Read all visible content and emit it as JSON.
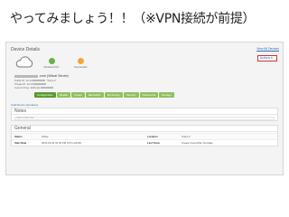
{
  "slide": {
    "title": "やってみましょう！！（※VPN接続が前提）"
  },
  "screenshot": {
    "header_title": "Device Details",
    "view_all_label": "View All Devices",
    "actions_label": "Actions ▾",
    "states": [
      {
        "label": "Powered On",
        "icon": "power-icon",
        "color": "#6ab04c"
      },
      {
        "label": "Connected",
        "icon": "connected-icon",
        "color": "#f2a63a"
      }
    ],
    "device_name_suffix": ".com (Virtual Server)",
    "info": [
      {
        "prefix": "Public IP: 10.13.",
        "suffix": " Tokyo 2"
      },
      {
        "prefix": "Private IP: 10.13.",
        "suffix": ""
      },
      {
        "prefix": "Current Time: 2015-02-",
        "suffix": ""
      }
    ],
    "tabs": [
      {
        "label": "Configuration",
        "active": true
      },
      {
        "label": "Details",
        "active": false
      },
      {
        "label": "Usage",
        "active": false
      },
      {
        "label": "Bandwidth",
        "active": false
      },
      {
        "label": "Monitoring",
        "active": false
      },
      {
        "label": "Security",
        "active": false
      },
      {
        "label": "Passwords",
        "active": false
      },
      {
        "label": "Storage",
        "active": false
      }
    ],
    "quick_link": "Audit Device Operations",
    "notes": {
      "title": "Notes",
      "placeholder": "Click to add note"
    },
    "general": {
      "title": "General",
      "rows": [
        {
          "k1": "Status",
          "v1": "Active",
          "k2": "Location",
          "v2": "Tokyo 2"
        },
        {
          "k1": "Start Date",
          "v1": "2015-02-02 02:39 PM (UTC+09:00)",
          "k2": "Last Trans",
          "v2": "Create Cloud Disk Template"
        }
      ]
    },
    "colors": {
      "accent_green": "#8fc060",
      "active_tab": "#5a9b2e",
      "actions_border": "#d9302c",
      "link_blue": "#2a6fb5"
    }
  }
}
